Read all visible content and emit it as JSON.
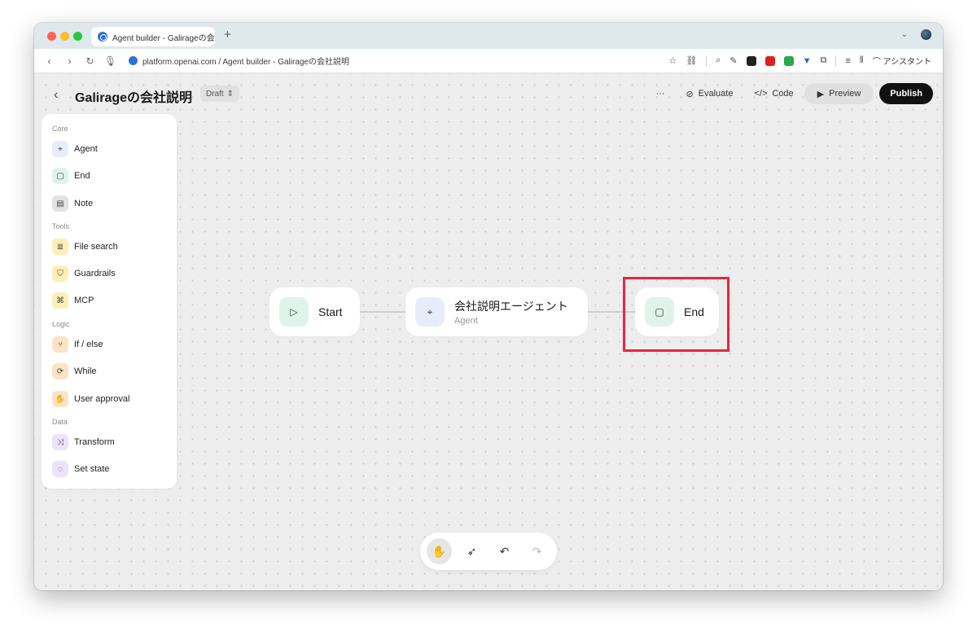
{
  "browser": {
    "tab_title": "Agent builder - Galirageの会",
    "new_tab_symbol": "+",
    "url": "platform.openai.com / Agent builder - Galirageの会社説明",
    "assistant_label": "アシスタント"
  },
  "header": {
    "title": "Galirageの会社説明",
    "status": "Draft",
    "more_symbol": "···",
    "evaluate": "Evaluate",
    "code": "Code",
    "preview": "Preview",
    "publish": "Publish"
  },
  "palette": {
    "sections": [
      {
        "title": "Core",
        "items": [
          {
            "label": "Agent",
            "icon": "cursor-icon",
            "color": "#e6ecfb"
          },
          {
            "label": "End",
            "icon": "stop-icon",
            "color": "#dff3ea"
          },
          {
            "label": "Note",
            "icon": "note-icon",
            "color": "#e2e2e2"
          }
        ]
      },
      {
        "title": "Tools",
        "items": [
          {
            "label": "File search",
            "icon": "database-icon",
            "color": "#fbefb5"
          },
          {
            "label": "Guardrails",
            "icon": "shield-icon",
            "color": "#fbefb5"
          },
          {
            "label": "MCP",
            "icon": "mcp-icon",
            "color": "#fbefb5"
          }
        ]
      },
      {
        "title": "Logic",
        "items": [
          {
            "label": "If / else",
            "icon": "branch-icon",
            "color": "#fde3c6"
          },
          {
            "label": "While",
            "icon": "loop-icon",
            "color": "#fde3c6"
          },
          {
            "label": "User approval",
            "icon": "approval-icon",
            "color": "#fde3c6"
          }
        ]
      },
      {
        "title": "Data",
        "items": [
          {
            "label": "Transform",
            "icon": "shuffle-icon",
            "color": "#ece2fb"
          },
          {
            "label": "Set state",
            "icon": "state-icon",
            "color": "#ece2fb"
          }
        ]
      }
    ]
  },
  "flow": {
    "start": {
      "label": "Start"
    },
    "agent": {
      "label": "会社説明エージェント",
      "sublabel": "Agent"
    },
    "end": {
      "label": "End"
    }
  },
  "colors": {
    "highlight": "#e8263c",
    "publish_bg": "#111111",
    "start_icon_bg": "#dff3ea",
    "agent_icon_bg": "#e6ecfb",
    "end_icon_bg": "#dff3ea"
  }
}
